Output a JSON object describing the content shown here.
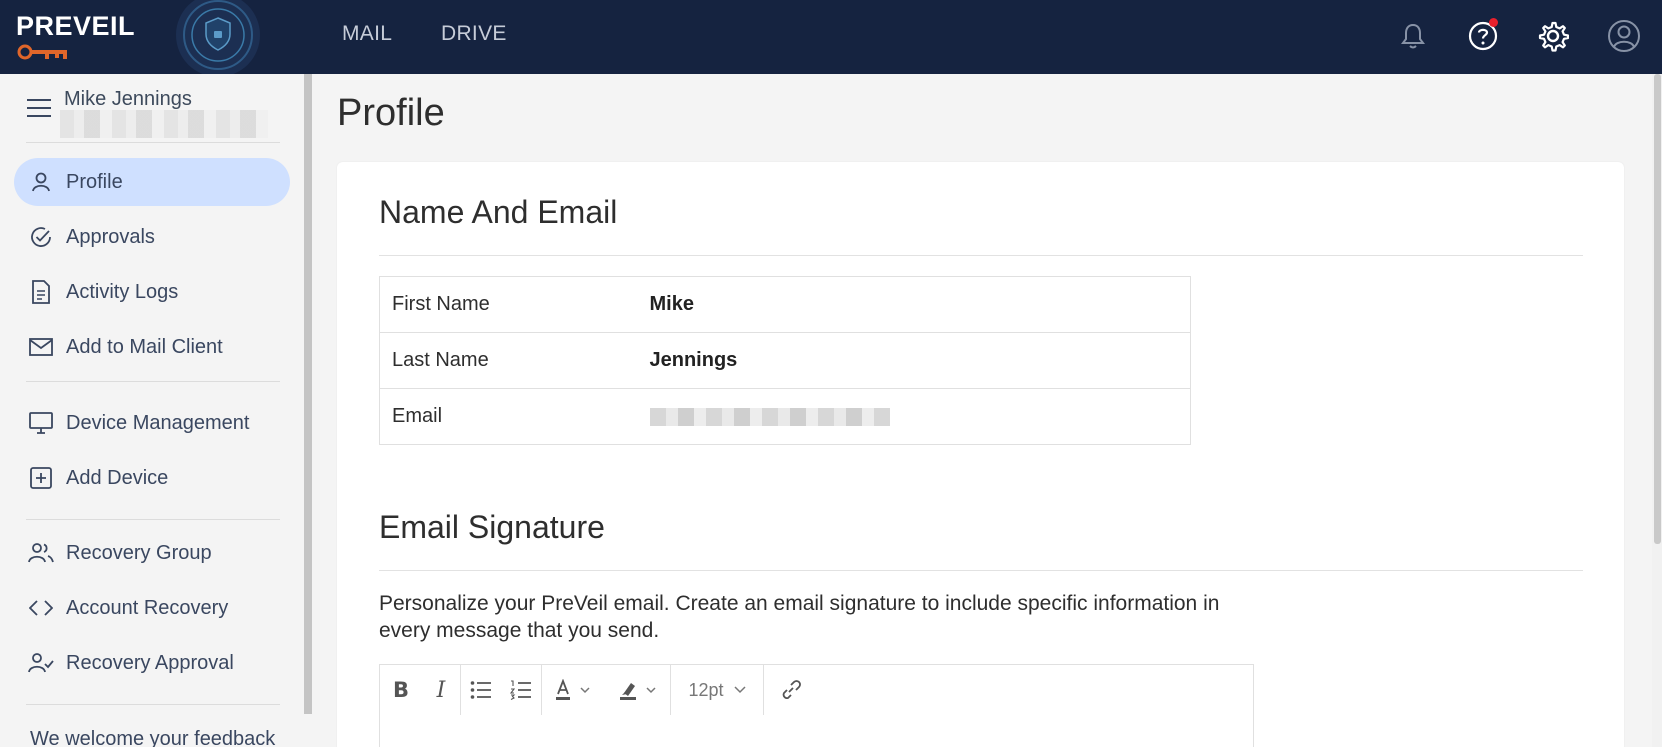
{
  "brand": {
    "name": "PREVEIL"
  },
  "colors": {
    "topbar": "#152340",
    "accent_active": "#cfe0ff",
    "notification_dot": "#e8202c",
    "key_orange": "#e0662a"
  },
  "topnav": {
    "mail": "MAIL",
    "drive": "DRIVE"
  },
  "topbar_icons": [
    "bell-icon",
    "help-icon",
    "gear-icon",
    "account-icon"
  ],
  "user": {
    "name": "Mike Jennings"
  },
  "sidebar": {
    "items": [
      {
        "label": "Profile",
        "icon": "person-icon",
        "active": true
      },
      {
        "label": "Approvals",
        "icon": "check-circle-icon"
      },
      {
        "label": "Activity Logs",
        "icon": "document-icon"
      },
      {
        "label": "Add to Mail Client",
        "icon": "envelope-icon"
      },
      {
        "label": "Device Management",
        "icon": "monitor-icon"
      },
      {
        "label": "Add Device",
        "icon": "plus-square-icon"
      },
      {
        "label": "Recovery Group",
        "icon": "group-icon"
      },
      {
        "label": "Account Recovery",
        "icon": "code-icon"
      },
      {
        "label": "Recovery Approval",
        "icon": "person-check-icon"
      }
    ],
    "feedback": "We welcome your feedback"
  },
  "page": {
    "title": "Profile"
  },
  "name_email": {
    "title": "Name And Email",
    "rows": [
      {
        "label": "First Name",
        "value": "Mike"
      },
      {
        "label": "Last Name",
        "value": "Jennings"
      },
      {
        "label": "Email",
        "value": ""
      }
    ]
  },
  "signature": {
    "title": "Email Signature",
    "description": "Personalize your PreVeil email. Create an email signature to include specific information in every message that you send.",
    "toolbar": {
      "bold": "B",
      "italic": "I",
      "font_size": "12pt"
    }
  }
}
